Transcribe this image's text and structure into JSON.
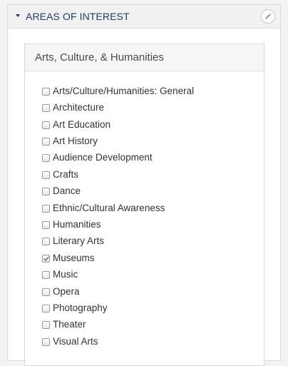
{
  "section": {
    "title": "AREAS OF INTEREST",
    "expand_icon": "caret-down-icon",
    "edit_icon": "pencil-icon"
  },
  "card": {
    "title": "Arts, Culture, & Humanities"
  },
  "options": [
    {
      "label": "Arts/Culture/Humanities: General",
      "checked": false
    },
    {
      "label": "Architecture",
      "checked": false
    },
    {
      "label": "Art Education",
      "checked": false
    },
    {
      "label": "Art History",
      "checked": false
    },
    {
      "label": "Audience Development",
      "checked": false
    },
    {
      "label": "Crafts",
      "checked": false
    },
    {
      "label": "Dance",
      "checked": false
    },
    {
      "label": "Ethnic/Cultural Awareness",
      "checked": false
    },
    {
      "label": "Humanities",
      "checked": false
    },
    {
      "label": "Literary Arts",
      "checked": false
    },
    {
      "label": "Museums",
      "checked": true
    },
    {
      "label": "Music",
      "checked": false
    },
    {
      "label": "Opera",
      "checked": false
    },
    {
      "label": "Photography",
      "checked": false
    },
    {
      "label": "Theater",
      "checked": false
    },
    {
      "label": "Visual Arts",
      "checked": false
    }
  ],
  "colors": {
    "header_text": "#1f3d63",
    "panel_bg": "#f1f1f1",
    "page_bg": "#f3f3f3"
  }
}
